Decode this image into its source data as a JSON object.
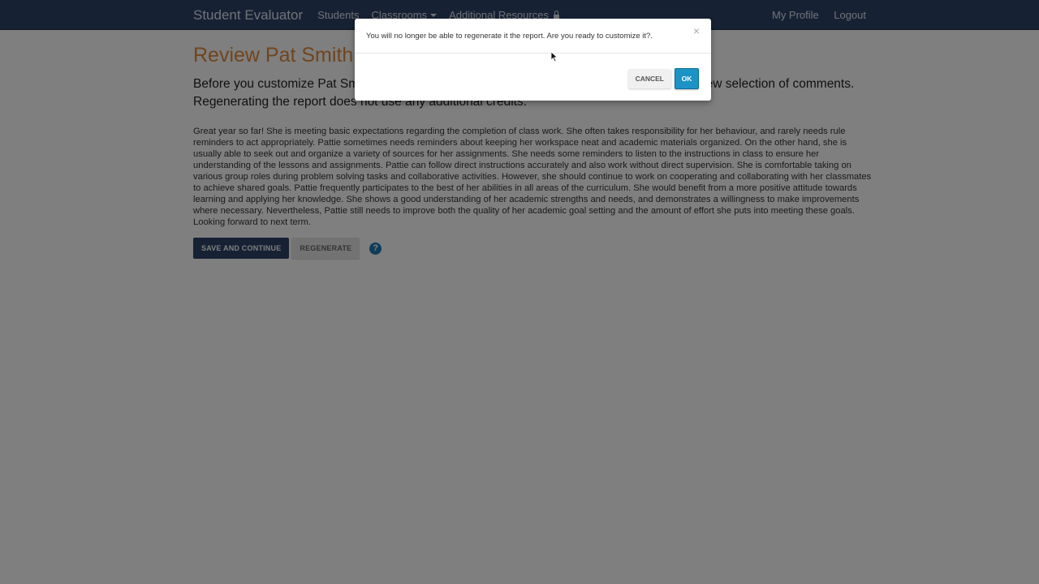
{
  "navbar": {
    "brand": "Student Evaluator",
    "links": [
      "Students",
      "Classrooms",
      "Additional Resources"
    ],
    "right_links": [
      "My Profile",
      "Logout"
    ]
  },
  "page": {
    "title": "Review Pat Smith",
    "intro": "Before you customize Pat Smith's report, you can review it. Click \"Regenerate\" below for a new selection of comments. Regenerating the report does not use any additional credits.",
    "report_text": "Great year so far! She is meeting basic expectations regarding the completion of class work. She often takes responsibility for her behaviour, and rarely needs rule reminders to act appropriately. Pattie sometimes needs reminders about keeping her workspace neat and academic materials organized. On the other hand, she is usually able to seek out and organize a variety of sources for her assignments. She needs some reminders to listen to the instructions in class to ensure her understanding of the lessons and assignments. Pattie can follow direct instructions accurately and also work without direct supervision. She is comfortable taking on various group roles during problem solving tasks and collaborative activities. However, she should continue to work on cooperating and collaborating with her classmates to achieve shared goals. Pattie frequently participates to the best of her abilities in all areas of the curriculum. She would benefit from a more positive attitude towards learning and applying her knowledge. She shows a good understanding of her academic strengths and needs, and demonstrates a willingness to make improvements where necessary. Nevertheless, Pattie still needs to improve both the quality of her academic goal setting and the amount of effort she puts into meeting these goals. Looking forward to next term.",
    "save_label": "SAVE AND CONTINUE",
    "regenerate_label": "REGENERATE",
    "help_glyph": "?"
  },
  "modal": {
    "message": "You will no longer be able to regenerate it the report. Are you ready to customize it?.",
    "close_glyph": "×",
    "cancel_label": "CANCEL",
    "ok_label": "OK"
  },
  "colors": {
    "navbar": "#2c4266",
    "title": "#e08a3a",
    "primary_button": "#2c4266",
    "ok_button": "#1c93c5",
    "help_icon": "#1f79b3"
  }
}
